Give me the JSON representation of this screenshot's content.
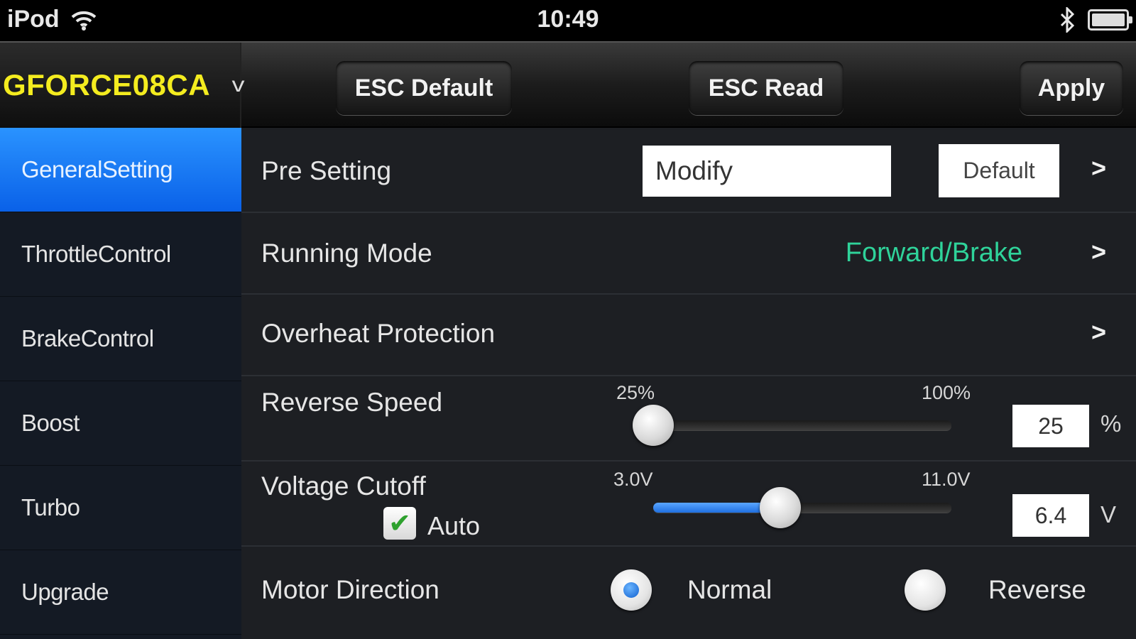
{
  "status_bar": {
    "device": "iPod",
    "time": "10:49"
  },
  "toolbar": {
    "device_name": "GFORCE08CA",
    "esc_default": "ESC Default",
    "esc_read": "ESC Read",
    "apply": "Apply"
  },
  "sidebar": {
    "items": [
      {
        "label": "GeneralSetting",
        "active": true
      },
      {
        "label": "ThrottleControl",
        "active": false
      },
      {
        "label": "BrakeControl",
        "active": false
      },
      {
        "label": "Boost",
        "active": false
      },
      {
        "label": "Turbo",
        "active": false
      },
      {
        "label": "Upgrade",
        "active": false
      }
    ]
  },
  "settings": {
    "pre_setting": {
      "label": "Pre Setting",
      "value": "Modify",
      "default_button": "Default"
    },
    "running_mode": {
      "label": "Running Mode",
      "value": "Forward/Brake"
    },
    "overheat": {
      "label": "Overheat Protection"
    },
    "reverse_speed": {
      "label": "Reverse Speed",
      "min_label": "25%",
      "max_label": "100%",
      "value": "25",
      "unit": "%",
      "level": 0.0
    },
    "voltage_cutoff": {
      "label": "Voltage Cutoff",
      "min_label": "3.0V",
      "max_label": "11.0V",
      "value": "6.4",
      "unit": "V",
      "level": 0.425,
      "auto_label": "Auto",
      "auto_checked": true
    },
    "motor_direction": {
      "label": "Motor Direction",
      "options": [
        "Normal",
        "Reverse"
      ],
      "selected": "Normal"
    }
  },
  "colors": {
    "device_name": "#f4ec1f",
    "active_item": "#1a7cf5",
    "running_mode_value": "#2fd39a",
    "slider_fill": "#2f83f0"
  }
}
